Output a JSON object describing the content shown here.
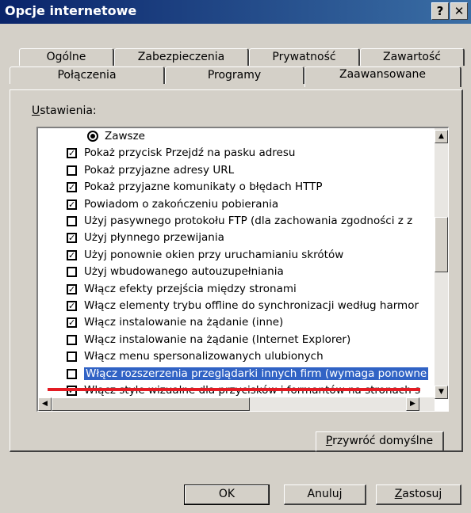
{
  "window": {
    "title": "Opcje internetowe",
    "help_label": "?",
    "close_label": "✕"
  },
  "tabs": {
    "row1": [
      "Ogólne",
      "Zabezpieczenia",
      "Prywatność",
      "Zawartość"
    ],
    "row2": [
      "Połączenia",
      "Programy",
      "Zaawansowane"
    ],
    "active": "Zaawansowane"
  },
  "settings": {
    "label": "Ustawienia:",
    "items": [
      {
        "type": "radio",
        "checked": true,
        "label": "Zawsze"
      },
      {
        "type": "checkbox",
        "checked": true,
        "label": "Pokaż przycisk Przejdź na pasku adresu"
      },
      {
        "type": "checkbox",
        "checked": false,
        "label": "Pokaż przyjazne adresy URL"
      },
      {
        "type": "checkbox",
        "checked": true,
        "label": "Pokaż przyjazne komunikaty o błędach HTTP"
      },
      {
        "type": "checkbox",
        "checked": true,
        "label": "Powiadom o zakończeniu pobierania"
      },
      {
        "type": "checkbox",
        "checked": false,
        "label": "Użyj pasywnego protokołu FTP (dla zachowania zgodności z z"
      },
      {
        "type": "checkbox",
        "checked": true,
        "label": "Użyj płynnego przewijania"
      },
      {
        "type": "checkbox",
        "checked": true,
        "label": "Użyj ponownie okien przy uruchamianiu skrótów"
      },
      {
        "type": "checkbox",
        "checked": false,
        "label": "Użyj wbudowanego autouzupełniania"
      },
      {
        "type": "checkbox",
        "checked": true,
        "label": "Włącz efekty przejścia między stronami"
      },
      {
        "type": "checkbox",
        "checked": true,
        "label": "Włącz elementy trybu offline do synchronizacji według harmor"
      },
      {
        "type": "checkbox",
        "checked": true,
        "label": "Włącz instalowanie na żądanie (inne)"
      },
      {
        "type": "checkbox",
        "checked": false,
        "label": "Włącz instalowanie na żądanie (Internet Explorer)"
      },
      {
        "type": "checkbox",
        "checked": false,
        "label": "Włącz menu spersonalizowanych ulubionych"
      },
      {
        "type": "checkbox",
        "checked": false,
        "label": "Włącz rozszerzenia przeglądarki innych firm (wymaga ponowne",
        "highlighted": true
      },
      {
        "type": "checkbox",
        "checked": true,
        "label": "Włącz style wizualne dla przycisków i formantów na stronach s"
      }
    ]
  },
  "buttons": {
    "restore_defaults": "Przywróć domyślne",
    "ok": "OK",
    "cancel": "Anuluj",
    "apply": "Zastosuj"
  },
  "colors": {
    "title_start": "#0a246a",
    "title_end": "#3a6ea5",
    "selection": "#3163c5",
    "annotation_line": "#e31b23"
  }
}
